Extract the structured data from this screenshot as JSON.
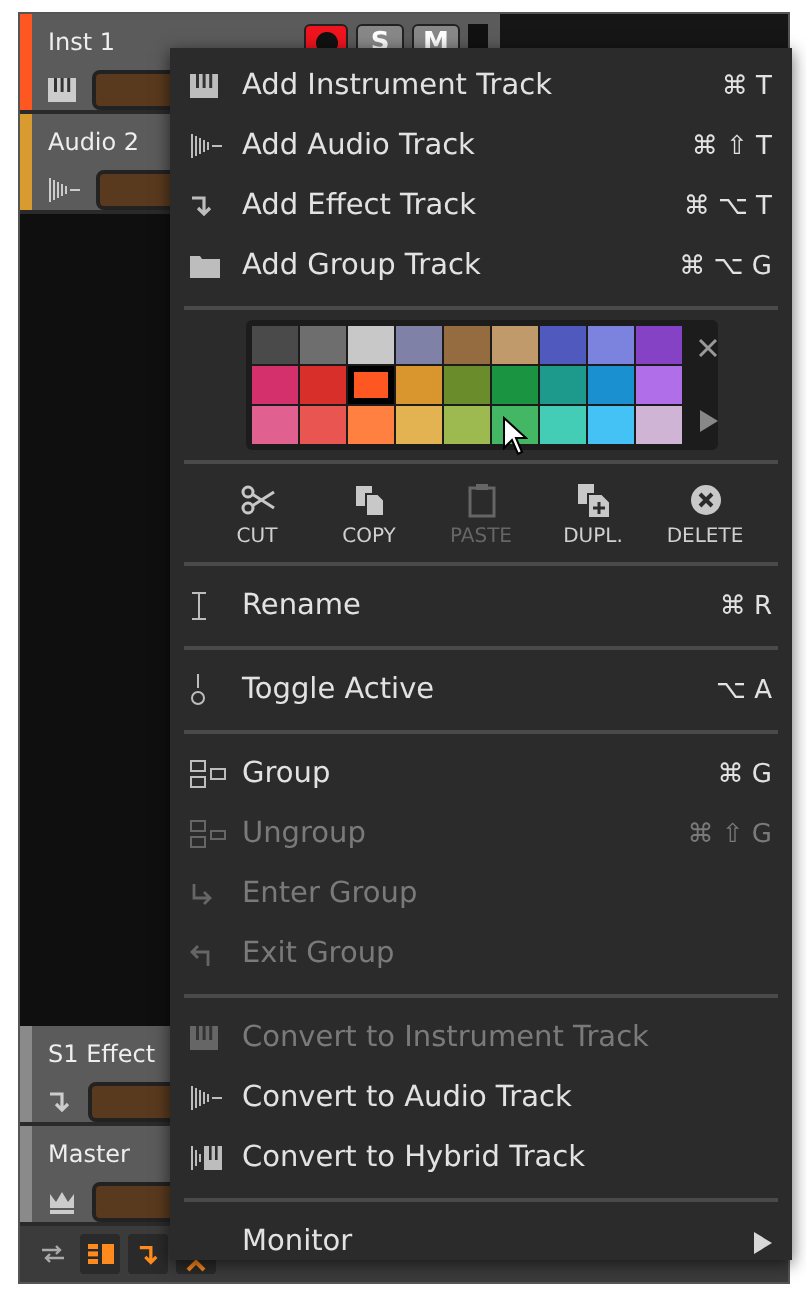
{
  "tracks": [
    {
      "name": "Inst 1",
      "kind": "instrument",
      "color": "#ff5722",
      "armed": true,
      "solo": "S",
      "mute": "M"
    },
    {
      "name": "Audio 2",
      "kind": "audio",
      "color": "#d89b30"
    },
    {
      "name": "S1 Effect",
      "kind": "effect",
      "color": "#8a8a8a"
    },
    {
      "name": "Master",
      "kind": "master",
      "color": "#8a8a8a"
    }
  ],
  "toolbar": [
    {
      "on": false
    },
    {
      "on": true
    },
    {
      "on": true
    },
    {
      "on": true
    }
  ],
  "menu": [
    {
      "kind": "item",
      "label": "Add Instrument Track",
      "shortcut": "⌘ T",
      "disabled": false
    },
    {
      "kind": "item",
      "label": "Add Audio Track",
      "shortcut": "⌘ ⇧ T",
      "disabled": false
    },
    {
      "kind": "item",
      "label": "Add Effect Track",
      "shortcut": "⌘ ⌥ T",
      "disabled": false
    },
    {
      "kind": "item",
      "label": "Add Group Track",
      "shortcut": "⌘ ⌥ G",
      "disabled": false
    },
    {
      "kind": "separator"
    },
    {
      "kind": "palette",
      "swatches": [
        {
          "color": "#4a4a4a",
          "selected": false
        },
        {
          "color": "#6e6e6e",
          "selected": false
        },
        {
          "color": "#c8c8c8",
          "selected": false
        },
        {
          "color": "#7f81a6",
          "selected": false
        },
        {
          "color": "#956c3f",
          "selected": false
        },
        {
          "color": "#c19a6b",
          "selected": false
        },
        {
          "color": "#5059be",
          "selected": false
        },
        {
          "color": "#7c83de",
          "selected": false
        },
        {
          "color": "#8642c4",
          "selected": false
        },
        {
          "color": "#d4306b",
          "selected": false
        },
        {
          "color": "#d82f2a",
          "selected": false
        },
        {
          "color": "#ff5722",
          "selected": true
        },
        {
          "color": "#d9962e",
          "selected": false
        },
        {
          "color": "#6a8c2a",
          "selected": false
        },
        {
          "color": "#1a9440",
          "selected": false
        },
        {
          "color": "#1d9a8c",
          "selected": false
        },
        {
          "color": "#1a90d0",
          "selected": false
        },
        {
          "color": "#b06ee8",
          "selected": false
        },
        {
          "color": "#e06090",
          "selected": false
        },
        {
          "color": "#e95550",
          "selected": false
        },
        {
          "color": "#ff8040",
          "selected": false
        },
        {
          "color": "#e3b352",
          "selected": false
        },
        {
          "color": "#9cba50",
          "selected": false
        },
        {
          "color": "#43b763",
          "selected": false
        },
        {
          "color": "#44cdb6",
          "selected": false
        },
        {
          "color": "#44c2f5",
          "selected": false
        },
        {
          "color": "#d0b4d6",
          "selected": false
        }
      ]
    },
    {
      "kind": "separator"
    },
    {
      "kind": "clipboard",
      "actions": [
        {
          "label": "CUT",
          "disabled": false
        },
        {
          "label": "COPY",
          "disabled": false
        },
        {
          "label": "PASTE",
          "disabled": true
        },
        {
          "label": "DUPL.",
          "disabled": false
        },
        {
          "label": "DELETE",
          "disabled": false
        }
      ]
    },
    {
      "kind": "separator"
    },
    {
      "kind": "item",
      "label": "Rename",
      "shortcut": "⌘ R",
      "disabled": false
    },
    {
      "kind": "separator"
    },
    {
      "kind": "item",
      "label": "Toggle Active",
      "shortcut": "⌥ A",
      "disabled": false
    },
    {
      "kind": "separator"
    },
    {
      "kind": "item",
      "label": "Group",
      "shortcut": "⌘ G",
      "disabled": false
    },
    {
      "kind": "item",
      "label": "Ungroup",
      "shortcut": "⌘ ⇧ G",
      "disabled": true
    },
    {
      "kind": "item",
      "label": "Enter Group",
      "disabled": true
    },
    {
      "kind": "item",
      "label": "Exit Group",
      "disabled": true
    },
    {
      "kind": "separator"
    },
    {
      "kind": "item",
      "label": "Convert to Instrument Track",
      "disabled": true
    },
    {
      "kind": "item",
      "label": "Convert to Audio Track",
      "disabled": false
    },
    {
      "kind": "item",
      "label": "Convert to Hybrid Track",
      "disabled": false
    },
    {
      "kind": "separator"
    },
    {
      "kind": "item",
      "label": "Monitor",
      "disabled": false,
      "submenu": true
    }
  ]
}
